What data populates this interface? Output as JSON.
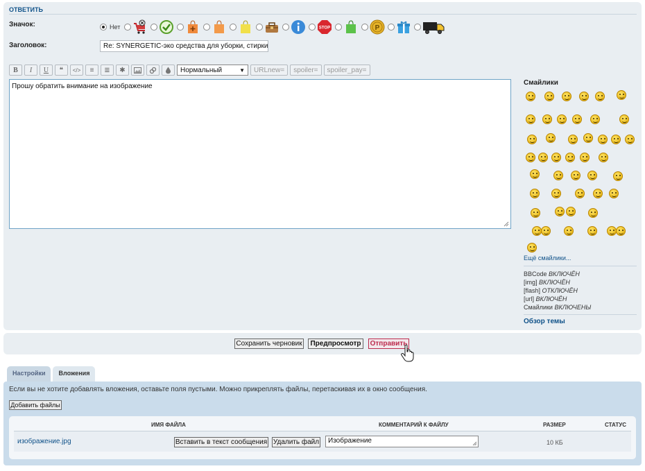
{
  "form": {
    "section_title": "Ответить",
    "icon_label": "Значок:",
    "icon_none_label": "Нет",
    "icons": [
      "cart-cancel-icon",
      "checkmark-icon",
      "shopping-bag-plus-icon",
      "shopping-bag-orange-icon",
      "shopping-bag-yellow-icon",
      "toolbox-icon",
      "info-icon",
      "stop-sign-icon",
      "shopping-bag-green-icon",
      "coin-p-icon",
      "gift-icon",
      "delivery-truck-icon"
    ],
    "subject_label": "Заголовок:",
    "subject_value": "Re: SYNERGETIC-эко средства для уборки, стирки и",
    "message_text": "Прошу обратить внимание на изображение"
  },
  "toolbar": {
    "buttons": [
      "B",
      "I",
      "U",
      "❝",
      "</>",
      "≡",
      "≣",
      "✱",
      "▣",
      "🔗",
      "💧"
    ],
    "button_names": [
      "bold",
      "italic",
      "underline",
      "quote",
      "code",
      "list",
      "list-numbered",
      "list-item",
      "image",
      "link",
      "color"
    ],
    "font_size_value": "Нормальный",
    "extra_buttons": [
      "URLnew=",
      "spoiler=",
      "spoiler_pay="
    ]
  },
  "sidebar": {
    "smilies_title": "Смайлики",
    "more_smilies": "Ещё смайлики...",
    "bbcode_status": [
      {
        "label": "BBCode",
        "state": "ВКЛЮЧЁН"
      },
      {
        "label": "[img]",
        "state": "ВКЛЮЧЁН"
      },
      {
        "label": "[flash]",
        "state": "ОТКЛЮЧЁН"
      },
      {
        "label": "[url]",
        "state": "ВКЛЮЧЁН"
      },
      {
        "label": "Смайлики",
        "state": "ВКЛЮЧЕНЫ"
      }
    ],
    "topic_review": "Обзор темы"
  },
  "actions": {
    "save_draft": "Сохранить черновик",
    "preview": "Предпросмотр",
    "submit": "Отправить"
  },
  "tabs": [
    "Настройки",
    "Вложения"
  ],
  "attachments": {
    "note": "Если вы не хотите добавлять вложения, оставьте поля пустыми. Можно прикреплять файлы, перетаскивая их в окно сообщения.",
    "add_files": "Добавить файлы",
    "headers": {
      "filename": "Имя файла",
      "comment": "Комментарий к файлу",
      "size": "Размер",
      "status": "Статус"
    },
    "file": {
      "name": "изображение.jpg",
      "insert_button": "Вставить в текст сообщения",
      "delete_button": "Удалить файл",
      "comment": "Изображение",
      "size": "10 КБ"
    }
  },
  "colors": {
    "panel_bg": "#e9eef2",
    "link": "#105289",
    "submit": "#bc2a4d",
    "attach_bg": "#cadceb"
  }
}
